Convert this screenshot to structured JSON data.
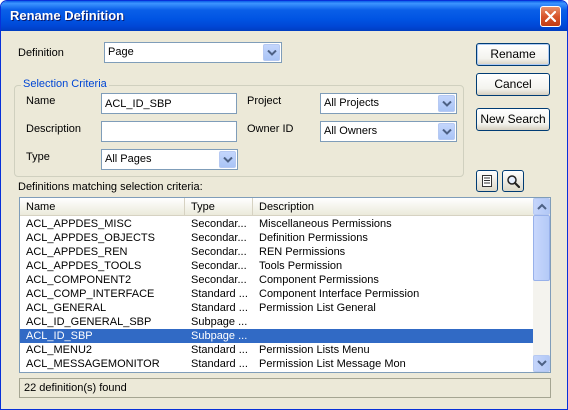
{
  "window": {
    "title": "Rename Definition"
  },
  "definition": {
    "label": "Definition",
    "value": "Page"
  },
  "selection_criteria": {
    "legend": "Selection Criteria",
    "name_label": "Name",
    "name_value": "ACL_ID_SBP",
    "description_label": "Description",
    "description_value": "",
    "type_label": "Type",
    "type_value": "All Pages",
    "project_label": "Project",
    "project_value": "All Projects",
    "owner_label": "Owner ID",
    "owner_value": "All Owners"
  },
  "buttons": {
    "rename": "Rename",
    "cancel": "Cancel",
    "new_search": "New Search"
  },
  "icons": {
    "properties": "properties-icon",
    "search": "magnifier-icon",
    "close": "close-icon"
  },
  "results": {
    "label": "Definitions matching selection criteria:",
    "columns": [
      "Name",
      "Type",
      "Description"
    ],
    "rows": [
      [
        "ACL_APPDES_MISC",
        "Secondar...",
        "Miscellaneous Permissions"
      ],
      [
        "ACL_APPDES_OBJECTS",
        "Secondar...",
        "Definition Permissions"
      ],
      [
        "ACL_APPDES_REN",
        "Secondar...",
        "REN Permissions"
      ],
      [
        "ACL_APPDES_TOOLS",
        "Secondar...",
        "Tools Permission"
      ],
      [
        "ACL_COMPONENT2",
        "Secondar...",
        "Component Permissions"
      ],
      [
        "ACL_COMP_INTERFACE",
        "Standard ...",
        "Component Interface Permission"
      ],
      [
        "ACL_GENERAL",
        "Standard ...",
        "Permission List General"
      ],
      [
        "ACL_ID_GENERAL_SBP",
        "Subpage ...",
        ""
      ],
      [
        "ACL_ID_SBP",
        "Subpage ...",
        ""
      ],
      [
        "ACL_MENU2",
        "Standard ...",
        "Permission Lists Menu"
      ],
      [
        "ACL_MESSAGEMONITOR",
        "Standard ...",
        "Permission List Message Mon"
      ]
    ],
    "selected_index": 8
  },
  "status": {
    "text": "22 definition(s) found"
  },
  "colors": {
    "titlebar": "#0054e3",
    "selection": "#316ac5",
    "dialog_bg": "#ece9d8",
    "legend": "#0046d5"
  }
}
